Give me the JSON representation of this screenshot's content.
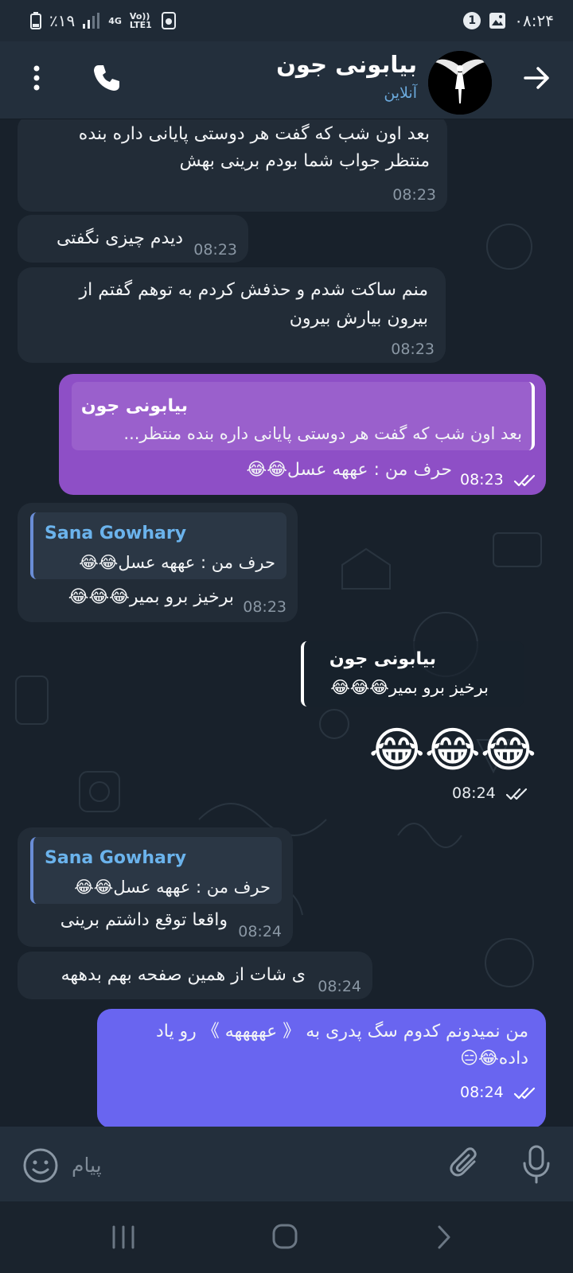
{
  "status_bar": {
    "battery": "٪۱۹",
    "network": "4G",
    "volte": "Vo)) LTE1",
    "notification_count": "1",
    "time": "۰۸:۲۴"
  },
  "header": {
    "title": "بیابونی جون",
    "status": "آنلاین"
  },
  "messages": [
    {
      "line1": "بعد اون شب که گفت هر دوستی پایانی داره بنده",
      "line2": "منتظر جواب شما بودم برینی بهش",
      "time": "08:23"
    },
    {
      "text": "دیدم چیزی نگفتی",
      "time": "08:23"
    },
    {
      "line1": "منم ساکت شدم و حذفش کردم به توهم گفتم از",
      "line2": "بیرون بیارش بیرون",
      "time": "08:23"
    },
    {
      "reply_name": "بیابونی جون",
      "reply_text": "بعد اون شب که گفت هر دوستی پایانی داره بنده منتظر...",
      "text": "حرف من : عههه عسل😂😂",
      "time": "08:23"
    },
    {
      "reply_name": "Sana Gowhary",
      "reply_text": "حرف من : عههه عسل😂😂",
      "text": "برخیز برو بمیر😂😂😂",
      "time": "08:23"
    },
    {
      "reply_name": "بیابونی جون",
      "reply_text": "برخیز برو بمیر😂😂😂",
      "text": "😂😂😂",
      "time": "08:24"
    },
    {
      "reply_name": "Sana Gowhary",
      "reply_text": "حرف من : عههه عسل😂😂",
      "text": "واقعا توقع داشتم برینی",
      "time": "08:24"
    },
    {
      "text": "ی شات از همین صفحه بهم بدههه",
      "time": "08:24"
    },
    {
      "line1": "من نمیدونم کدوم سگ پدری به 《 عههههه 》 رو یاد",
      "line2": "داده😂😑",
      "time": "08:24"
    }
  ],
  "input": {
    "placeholder": "پیام"
  },
  "colors": {
    "background": "#18212b",
    "header": "#232f3c",
    "incoming_bubble": "#222c37",
    "outgoing_purple": "#8e4fc6",
    "outgoing_blue": "#6965f0",
    "accent": "#6bb3ec"
  },
  "icons": [
    "back-arrow-icon",
    "phone-icon",
    "more-vert-icon",
    "emoji-icon",
    "attach-icon",
    "mic-icon",
    "double-check-icon"
  ]
}
